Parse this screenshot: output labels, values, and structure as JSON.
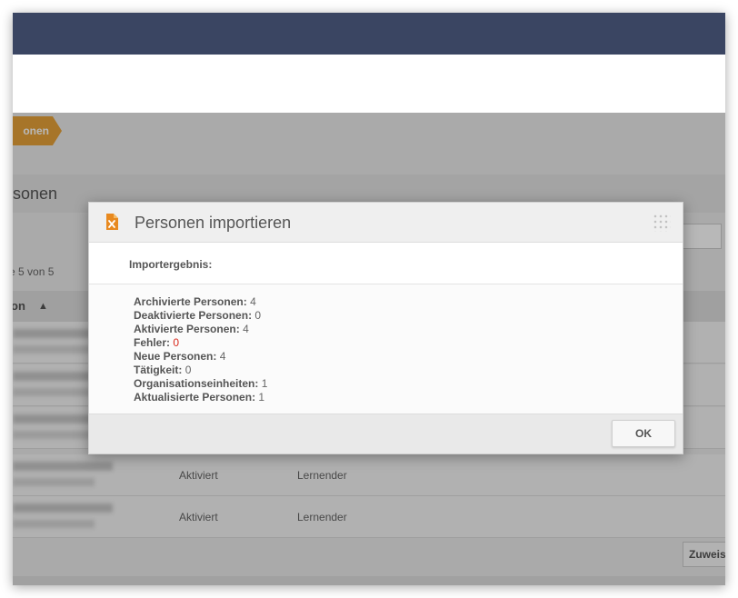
{
  "background": {
    "breadcrumb_label": "onen",
    "section_title": "rsonen",
    "paging_text": "e 5 von 5",
    "table_header": {
      "name_col": "on",
      "sort_icon": "▲"
    },
    "rows": [
      {
        "status": "",
        "role": ""
      },
      {
        "status": "",
        "role": ""
      },
      {
        "status": "",
        "role": ""
      },
      {
        "status": "Aktiviert",
        "role": "Lernender"
      },
      {
        "status": "Aktiviert",
        "role": "Lernender"
      }
    ],
    "assign_button": "Zuweis"
  },
  "modal": {
    "icon": "excel-file-icon",
    "title": "Personen importieren",
    "subtitle": "Importergebnis:",
    "results": [
      {
        "label": "Archivierte Personen",
        "value": "4"
      },
      {
        "label": "Deaktivierte Personen",
        "value": "0"
      },
      {
        "label": "Aktivierte Personen",
        "value": "4"
      },
      {
        "label": "Fehler",
        "value": "0"
      },
      {
        "label": "Neue Personen",
        "value": "4"
      },
      {
        "label": "Tätigkeit",
        "value": "0"
      },
      {
        "label": "Organisationseinheiten",
        "value": "1"
      },
      {
        "label": "Aktualisierte Personen",
        "value": "1"
      }
    ],
    "separator": ":",
    "ok_label": "OK"
  },
  "colors": {
    "topbar": "#3a4562",
    "accent_orange": "#e8a33a",
    "error_red": "#d9291c"
  }
}
